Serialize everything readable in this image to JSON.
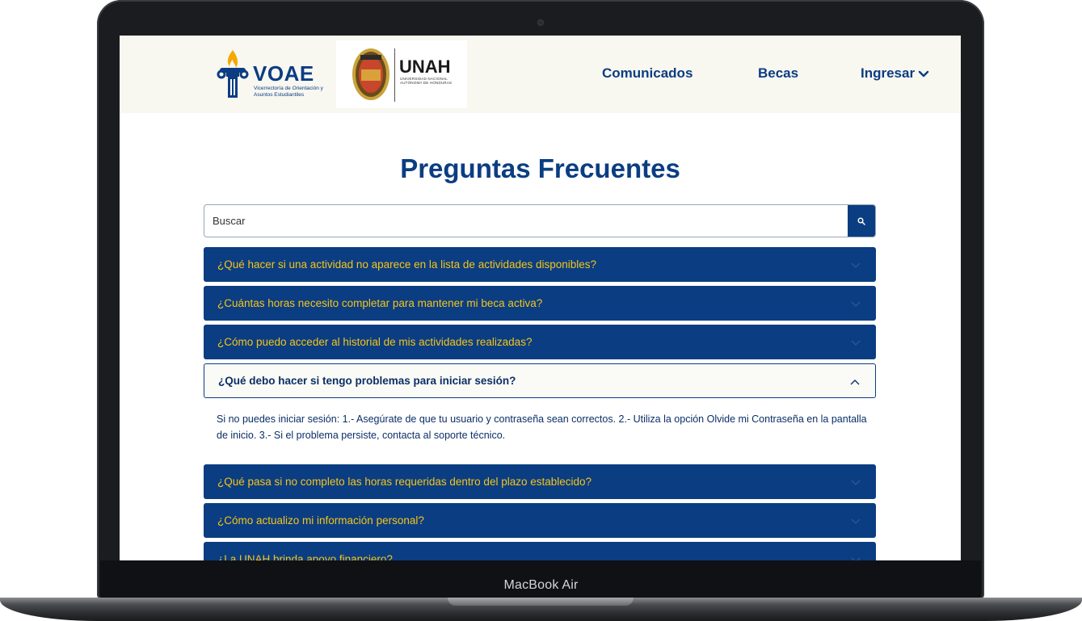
{
  "device": {
    "label": "MacBook Air"
  },
  "header": {
    "voae_logo": {
      "name": "VOAE",
      "subtitle": "Vicerrectoría de Orientación y Asuntos Estudiantiles"
    },
    "unah_logo": {
      "name": "UNAH",
      "subtitle": "UNIVERSIDAD NACIONAL AUTÓNOMA DE HONDURAS"
    },
    "nav": {
      "comunicados": "Comunicados",
      "becas": "Becas",
      "ingresar": "Ingresar"
    }
  },
  "main": {
    "title": "Preguntas Frecuentes",
    "search": {
      "placeholder": "Buscar",
      "value": ""
    },
    "faqs": [
      {
        "question": "¿Qué hacer si una actividad no aparece en la lista de actividades disponibles?"
      },
      {
        "question": "¿Cuántas horas necesito completar para mantener mi beca activa?"
      },
      {
        "question": "¿Cómo puedo acceder al historial de mis actividades realizadas?"
      },
      {
        "question": "¿Qué debo hacer si tengo problemas para iniciar sesión?",
        "answer": "Si no puedes iniciar sesión: 1.- Asegúrate de que tu usuario y contraseña sean correctos. 2.- Utiliza la opción Olvide mi Contraseña en la pantalla de inicio. 3.- Si el problema persiste, contacta al soporte técnico.",
        "expanded": true
      },
      {
        "question": "¿Qué pasa si no completo las horas requeridas dentro del plazo establecido?"
      },
      {
        "question": "¿Cómo actualizo mi información personal?"
      },
      {
        "question": "¿La UNAH brinda apoyo financiero?"
      }
    ]
  },
  "colors": {
    "primary": "#0b3d82",
    "accent": "#f5c518",
    "header_bg": "#f8f7f0"
  },
  "icons": {
    "search": "search-icon",
    "chevron_down": "chevron-down-icon",
    "chevron_up": "chevron-up-icon"
  }
}
